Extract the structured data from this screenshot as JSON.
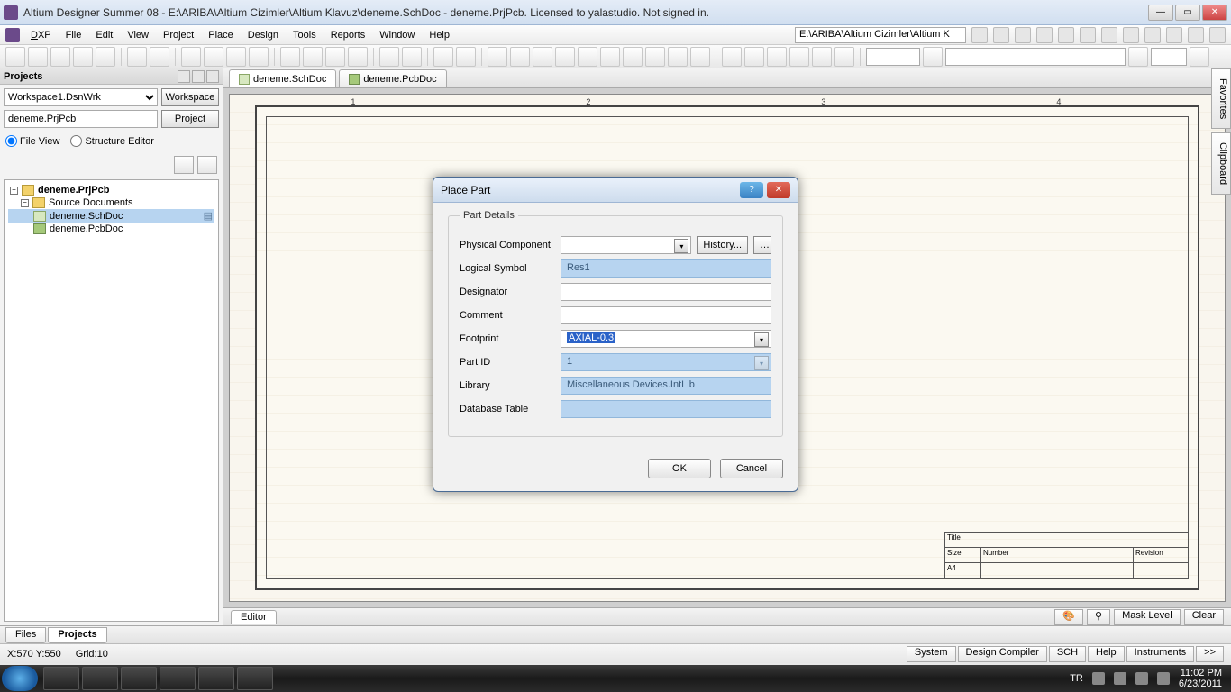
{
  "titlebar": "Altium Designer Summer 08 - E:\\ARIBA\\Altium Cizimler\\Altium Klavuz\\deneme.SchDoc - deneme.PrjPcb. Licensed to yalastudio. Not signed in.",
  "menu": {
    "dxp": "DXP",
    "file": "File",
    "edit": "Edit",
    "view": "View",
    "project": "Project",
    "place": "Place",
    "design": "Design",
    "tools": "Tools",
    "reports": "Reports",
    "window": "Window",
    "help": "Help"
  },
  "path_box": "E:\\ARIBA\\Altium Cizimler\\Altium K",
  "left_panel": {
    "header": "Projects",
    "workspace": "Workspace1.DsnWrk",
    "ws_btn": "Workspace",
    "project_value": "deneme.PrjPcb",
    "project_btn": "Project",
    "view_file": "File View",
    "view_structure": "Structure Editor",
    "tree_root": "deneme.PrjPcb",
    "tree_folder": "Source Documents",
    "tree_sch": "deneme.SchDoc",
    "tree_pcb": "deneme.PcbDoc"
  },
  "tabs": {
    "sch": "deneme.SchDoc",
    "pcb": "deneme.PcbDoc"
  },
  "title_block": {
    "title": "Title",
    "size": "Size",
    "a4": "A4",
    "number": "Number",
    "revision": "Revision"
  },
  "sheet_ruler": {
    "n1": "1",
    "n2": "2",
    "n3": "3",
    "n4": "4"
  },
  "editor_tab": "Editor",
  "editor_right": {
    "mask": "Mask Level",
    "clear": "Clear"
  },
  "files_tabs": {
    "files": "Files",
    "projects": "Projects"
  },
  "status": {
    "coord": "X:570 Y:550",
    "grid": "Grid:10",
    "system": "System",
    "compiler": "Design Compiler",
    "sch": "SCH",
    "help": "Help",
    "instruments": "Instruments",
    "more": ">>"
  },
  "right_rail": {
    "fav": "Favorites",
    "clip": "Clipboard"
  },
  "dialog": {
    "title": "Place Part",
    "fs_legend": "Part Details",
    "physical": "Physical Component",
    "history": "History...",
    "logical": "Logical Symbol",
    "logical_val": "Res1",
    "designator": "Designator",
    "comment": "Comment",
    "footprint": "Footprint",
    "footprint_val": "AXIAL-0.3",
    "partid": "Part ID",
    "partid_val": "1",
    "library": "Library",
    "library_val": "Miscellaneous Devices.IntLib",
    "dbtable": "Database Table",
    "ok": "OK",
    "cancel": "Cancel"
  },
  "taskbar": {
    "lang": "TR",
    "time": "11:02 PM",
    "date": "6/23/2011"
  }
}
